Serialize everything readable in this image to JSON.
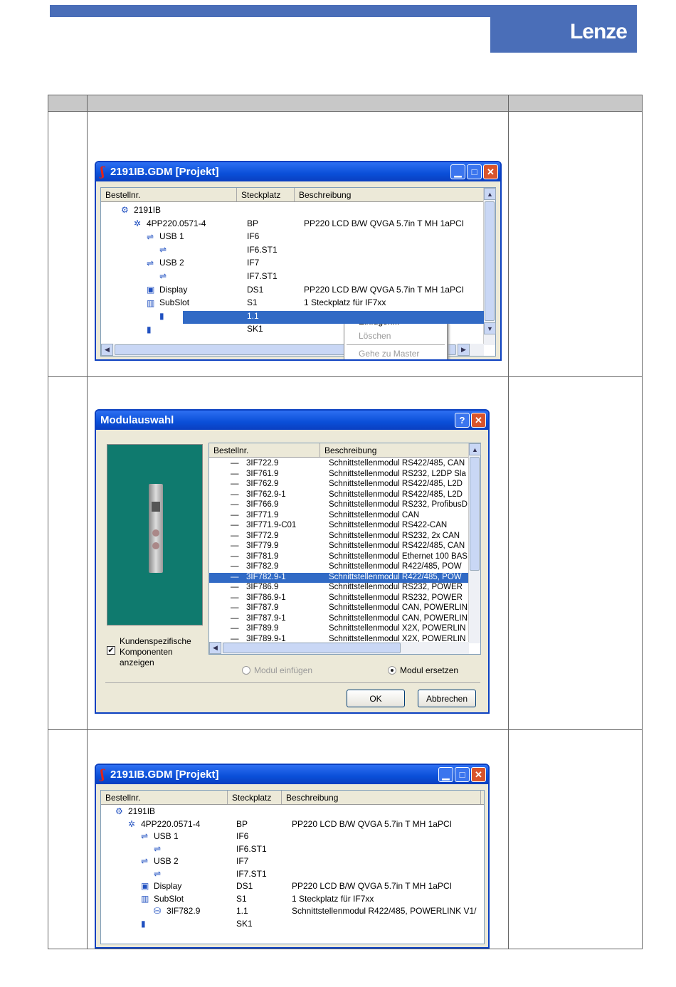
{
  "brand": {
    "logo_text": "Lenze",
    "color": "#4a6eb8"
  },
  "win1": {
    "title": "2191IB.GDM [Projekt]",
    "columns": [
      "Bestellnr.",
      "Steckplatz",
      "Beschreibung"
    ],
    "rows": [
      {
        "name": "2191IB",
        "slot": "",
        "desc": "",
        "indent": 0,
        "icon": "network-icon"
      },
      {
        "name": "4PP220.0571-4",
        "slot": "BP",
        "desc": "PP220 LCD B/W QVGA 5.7in T MH 1aPCI",
        "indent": 1,
        "icon": "module-icon"
      },
      {
        "name": "USB 1",
        "slot": "IF6",
        "desc": "",
        "indent": 2,
        "icon": "usb-icon"
      },
      {
        "name": "",
        "slot": "IF6.ST1",
        "desc": "",
        "indent": 3,
        "icon": "usb-icon"
      },
      {
        "name": "USB 2",
        "slot": "IF7",
        "desc": "",
        "indent": 2,
        "icon": "usb-icon"
      },
      {
        "name": "",
        "slot": "IF7.ST1",
        "desc": "",
        "indent": 3,
        "icon": "usb-icon"
      },
      {
        "name": "Display",
        "slot": "DS1",
        "desc": "PP220 LCD B/W QVGA 5.7in T MH 1aPCI",
        "indent": 2,
        "icon": "display-icon"
      },
      {
        "name": "SubSlot",
        "slot": "S1",
        "desc": "1 Steckplatz für IF7xx",
        "indent": 2,
        "icon": "subslot-icon"
      },
      {
        "name": "",
        "slot": "1.1",
        "desc": "",
        "indent": 3,
        "icon": "slot-icon",
        "selected": true
      },
      {
        "name": "",
        "slot": "SK1",
        "desc": "",
        "indent": 2,
        "icon": "slot-icon"
      }
    ],
    "context_menu": [
      {
        "label": "Einfügen...",
        "enabled": true
      },
      {
        "label": "Löschen",
        "enabled": false
      },
      {
        "label": "Gehe zu Master",
        "enabled": false
      }
    ]
  },
  "win2": {
    "title": "Modulauswahl",
    "columns": [
      "Bestellnr.",
      "Beschreibung"
    ],
    "rows": [
      {
        "nr": "3IF722.9",
        "desc": "Schnittstellenmodul RS422/485, CAN"
      },
      {
        "nr": "3IF761.9",
        "desc": "Schnittstellenmodul RS232, L2DP Sla"
      },
      {
        "nr": "3IF762.9",
        "desc": "Schnittstellenmodul RS422/485, L2D"
      },
      {
        "nr": "3IF762.9-1",
        "desc": "Schnittstellenmodul RS422/485, L2D"
      },
      {
        "nr": "3IF766.9",
        "desc": "Schnittstellenmodul RS232, ProfibusD"
      },
      {
        "nr": "3IF771.9",
        "desc": "Schnittstellenmodul CAN"
      },
      {
        "nr": "3IF771.9-C01",
        "desc": "Schnittstellenmodul RS422-CAN"
      },
      {
        "nr": "3IF772.9",
        "desc": "Schnittstellenmodul RS232, 2x CAN"
      },
      {
        "nr": "3IF779.9",
        "desc": "Schnittstellenmodul RS422/485, CAN"
      },
      {
        "nr": "3IF781.9",
        "desc": "Schnittstellenmodul Ethernet 100 BAS"
      },
      {
        "nr": "3IF782.9",
        "desc": "Schnittstellenmodul R422/485, POW"
      },
      {
        "nr": "3IF782.9-1",
        "desc": "Schnittstellenmodul R422/485, POW",
        "selected": true
      },
      {
        "nr": "3IF786.9",
        "desc": "Schnittstellenmodul RS232, POWER"
      },
      {
        "nr": "3IF786.9-1",
        "desc": "Schnittstellenmodul RS232, POWER"
      },
      {
        "nr": "3IF787.9",
        "desc": "Schnittstellenmodul CAN, POWERLIN"
      },
      {
        "nr": "3IF787.9-1",
        "desc": "Schnittstellenmodul CAN, POWERLIN"
      },
      {
        "nr": "3IF789.9",
        "desc": "Schnittstellenmodul X2X, POWERLIN"
      },
      {
        "nr": "3IF789.9-1",
        "desc": "Schnittstellenmodul X2X, POWERLIN"
      }
    ],
    "checkbox_label_lines": [
      "Kundenspezifische",
      "Komponenten",
      "anzeigen"
    ],
    "checkbox_checked": true,
    "radio_insert": "Modul einfügen",
    "radio_replace": "Modul ersetzen",
    "ok": "OK",
    "cancel": "Abbrechen",
    "help": "?",
    "preview_bg": "#0f7a6e"
  },
  "win3": {
    "title": "2191IB.GDM [Projekt]",
    "columns": [
      "Bestellnr.",
      "Steckplatz",
      "Beschreibung"
    ],
    "rows": [
      {
        "name": "2191IB",
        "slot": "",
        "desc": "",
        "indent": 0,
        "icon": "network-icon"
      },
      {
        "name": "4PP220.0571-4",
        "slot": "BP",
        "desc": "PP220 LCD B/W QVGA 5.7in T MH 1aPCI",
        "indent": 1,
        "icon": "module-icon"
      },
      {
        "name": "USB 1",
        "slot": "IF6",
        "desc": "",
        "indent": 2,
        "icon": "usb-icon"
      },
      {
        "name": "",
        "slot": "IF6.ST1",
        "desc": "",
        "indent": 3,
        "icon": "usb-icon"
      },
      {
        "name": "USB 2",
        "slot": "IF7",
        "desc": "",
        "indent": 2,
        "icon": "usb-icon"
      },
      {
        "name": "",
        "slot": "IF7.ST1",
        "desc": "",
        "indent": 3,
        "icon": "usb-icon"
      },
      {
        "name": "Display",
        "slot": "DS1",
        "desc": "PP220 LCD B/W QVGA 5.7in T MH 1aPCI",
        "indent": 2,
        "icon": "display-icon"
      },
      {
        "name": "SubSlot",
        "slot": "S1",
        "desc": "1 Steckplatz für IF7xx",
        "indent": 2,
        "icon": "subslot-icon"
      },
      {
        "name": "3IF782.9",
        "slot": "1.1",
        "desc": "Schnittstellenmodul R422/485, POWERLINK V1/",
        "indent": 3,
        "icon": "interface-module-icon"
      },
      {
        "name": "",
        "slot": "SK1",
        "desc": "",
        "indent": 2,
        "icon": "slot-icon"
      }
    ]
  }
}
